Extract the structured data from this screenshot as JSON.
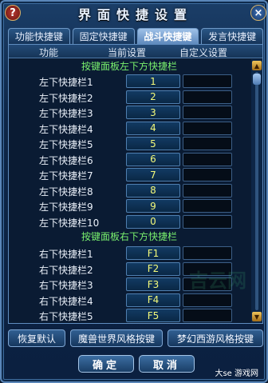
{
  "window": {
    "title": "界面快捷设置",
    "help_icon": "question-mark",
    "close_icon": "x"
  },
  "tabs": [
    {
      "label": "功能快捷键",
      "active": false
    },
    {
      "label": "固定快捷键",
      "active": false
    },
    {
      "label": "战斗快捷键",
      "active": true
    },
    {
      "label": "发言快捷键",
      "active": false
    }
  ],
  "table": {
    "headers": {
      "function": "功能",
      "current": "当前设置",
      "custom": "自定义设置"
    },
    "sections": [
      {
        "title": "按键面板左下方快捷栏",
        "rows": [
          {
            "label": "左下快捷栏1",
            "key": "1"
          },
          {
            "label": "左下快捷栏2",
            "key": "2"
          },
          {
            "label": "左下快捷栏3",
            "key": "3"
          },
          {
            "label": "左下快捷栏4",
            "key": "4"
          },
          {
            "label": "左下快捷栏5",
            "key": "5"
          },
          {
            "label": "左下快捷栏6",
            "key": "6"
          },
          {
            "label": "左下快捷栏7",
            "key": "7"
          },
          {
            "label": "左下快捷栏8",
            "key": "8"
          },
          {
            "label": "左下快捷栏9",
            "key": "9"
          },
          {
            "label": "左下快捷栏10",
            "key": "0"
          }
        ]
      },
      {
        "title": "按键面板右下方快捷栏",
        "rows": [
          {
            "label": "右下快捷栏1",
            "key": "F1"
          },
          {
            "label": "右下快捷栏2",
            "key": "F2"
          },
          {
            "label": "右下快捷栏3",
            "key": "F3"
          },
          {
            "label": "右下快捷栏4",
            "key": "F4"
          },
          {
            "label": "右下快捷栏5",
            "key": "F5"
          }
        ]
      }
    ]
  },
  "buttons": {
    "restore_default": "恢复默认",
    "wow_style": "魔兽世界风格按键",
    "mhxy_style": "梦幻西游风格按键",
    "confirm": "确定",
    "cancel": "取消"
  },
  "watermark": "吉云网",
  "logo": "大se 游戏网"
}
